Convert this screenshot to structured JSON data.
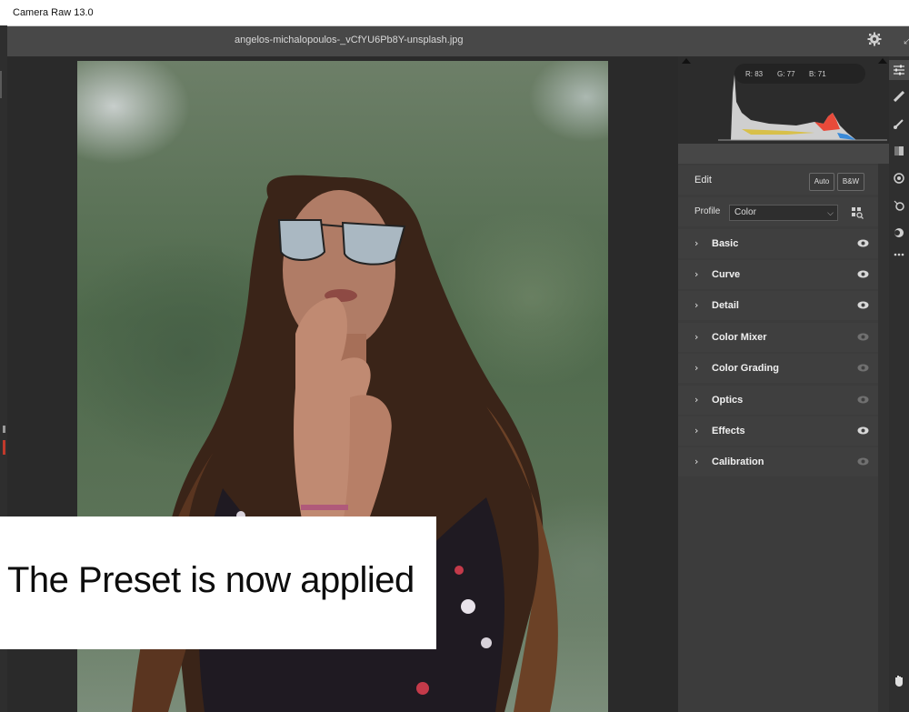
{
  "window": {
    "title": "Camera Raw 13.0"
  },
  "file": {
    "name": "angelos-michalopoulos-_vCfYU6Pb8Y-unsplash.jpg"
  },
  "toolbar": {
    "settings_icon": "gear-icon",
    "expand_icon": "expand-icon"
  },
  "histogram": {
    "readout": {
      "r": "R: 83",
      "g": "G: 77",
      "b": "B: 71"
    }
  },
  "edit": {
    "title": "Edit",
    "auto_label": "Auto",
    "bw_label": "B&W",
    "profile_label": "Profile",
    "profile_value": "Color",
    "profile_browser_icon": "grid-icon"
  },
  "sections": [
    {
      "label": "Basic",
      "visible": true
    },
    {
      "label": "Curve",
      "visible": true
    },
    {
      "label": "Detail",
      "visible": true
    },
    {
      "label": "Color Mixer",
      "visible": false
    },
    {
      "label": "Color Grading",
      "visible": false
    },
    {
      "label": "Optics",
      "visible": false
    },
    {
      "label": "Effects",
      "visible": true
    },
    {
      "label": "Calibration",
      "visible": false
    }
  ],
  "tools": [
    "edit-sliders-icon",
    "healing-icon",
    "brush-icon",
    "gradient-icon",
    "radial-icon",
    "redeye-icon",
    "presets-icon",
    "more-icon",
    "hand-icon"
  ],
  "overlay": {
    "caption": "The Preset is now applied"
  },
  "colors": {
    "panel_bg": "#3c3c3c",
    "section_bg": "#3f3f3f",
    "canvas_bg": "#2a2a2a"
  }
}
